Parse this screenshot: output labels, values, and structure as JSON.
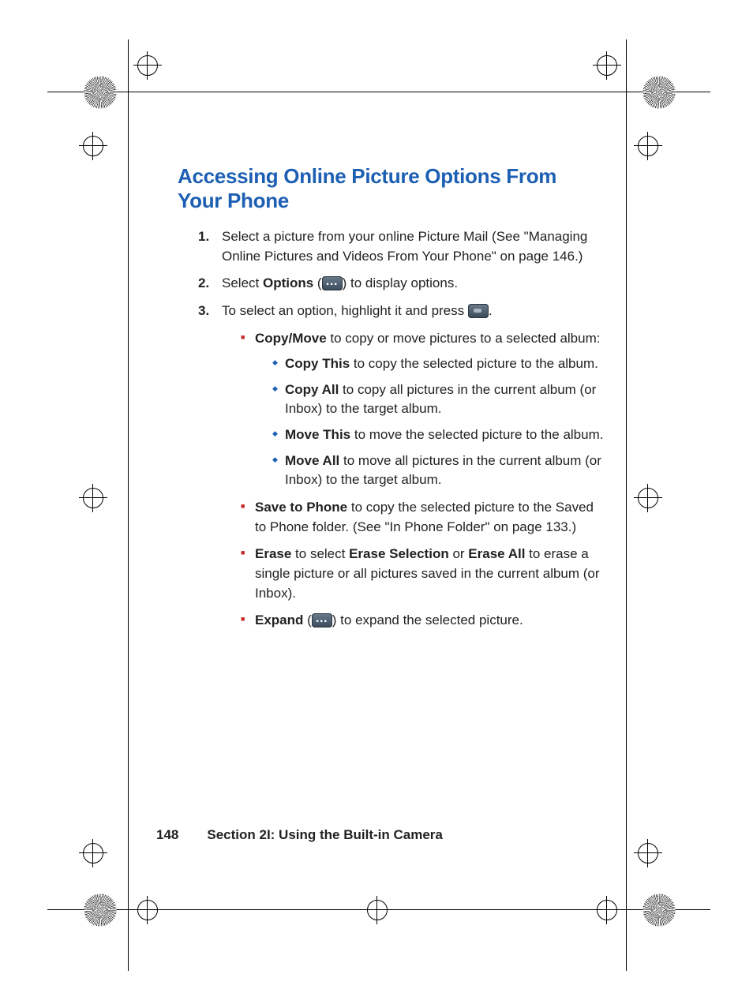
{
  "heading": "Accessing Online Picture Options From Your Phone",
  "steps": {
    "s1": "Select a picture from your online Picture Mail (See \"Managing Online Pictures and Videos From Your Phone\" on page 146.)",
    "s2_a": "Select ",
    "s2_b": "Options",
    "s2_c": " (",
    "s2_d": ") to display options.",
    "s3_a": "To select an option, highlight it and press ",
    "s3_b": "."
  },
  "bullets": {
    "copymove": {
      "label": "Copy/Move",
      "text": " to copy or move pictures to a selected album:",
      "sub": {
        "copythis_label": "Copy This",
        "copythis_text": " to copy the selected picture to the album.",
        "copyall_label": "Copy All",
        "copyall_text": " to copy all pictures in the current album (or Inbox) to the target album.",
        "movethis_label": "Move This",
        "movethis_text": " to move the selected picture to the album.",
        "moveall_label": "Move All",
        "moveall_text": " to move all pictures in the current album (or Inbox) to the target album."
      }
    },
    "save": {
      "label": "Save to Phone",
      "text": " to copy the selected picture to the Saved to Phone folder. (See \"In Phone Folder\" on page 133.)"
    },
    "erase": {
      "label": "Erase",
      "text_a": " to select ",
      "sel": "Erase Selection",
      "text_b": " or ",
      "all": "Erase All",
      "text_c": " to erase a single picture or all pictures saved in the current album (or Inbox)."
    },
    "expand": {
      "label": "Expand",
      "text_a": " (",
      "text_b": ") to expand the selected picture."
    }
  },
  "footer": {
    "page": "148",
    "section": "Section 2I: Using the Built-in Camera"
  }
}
